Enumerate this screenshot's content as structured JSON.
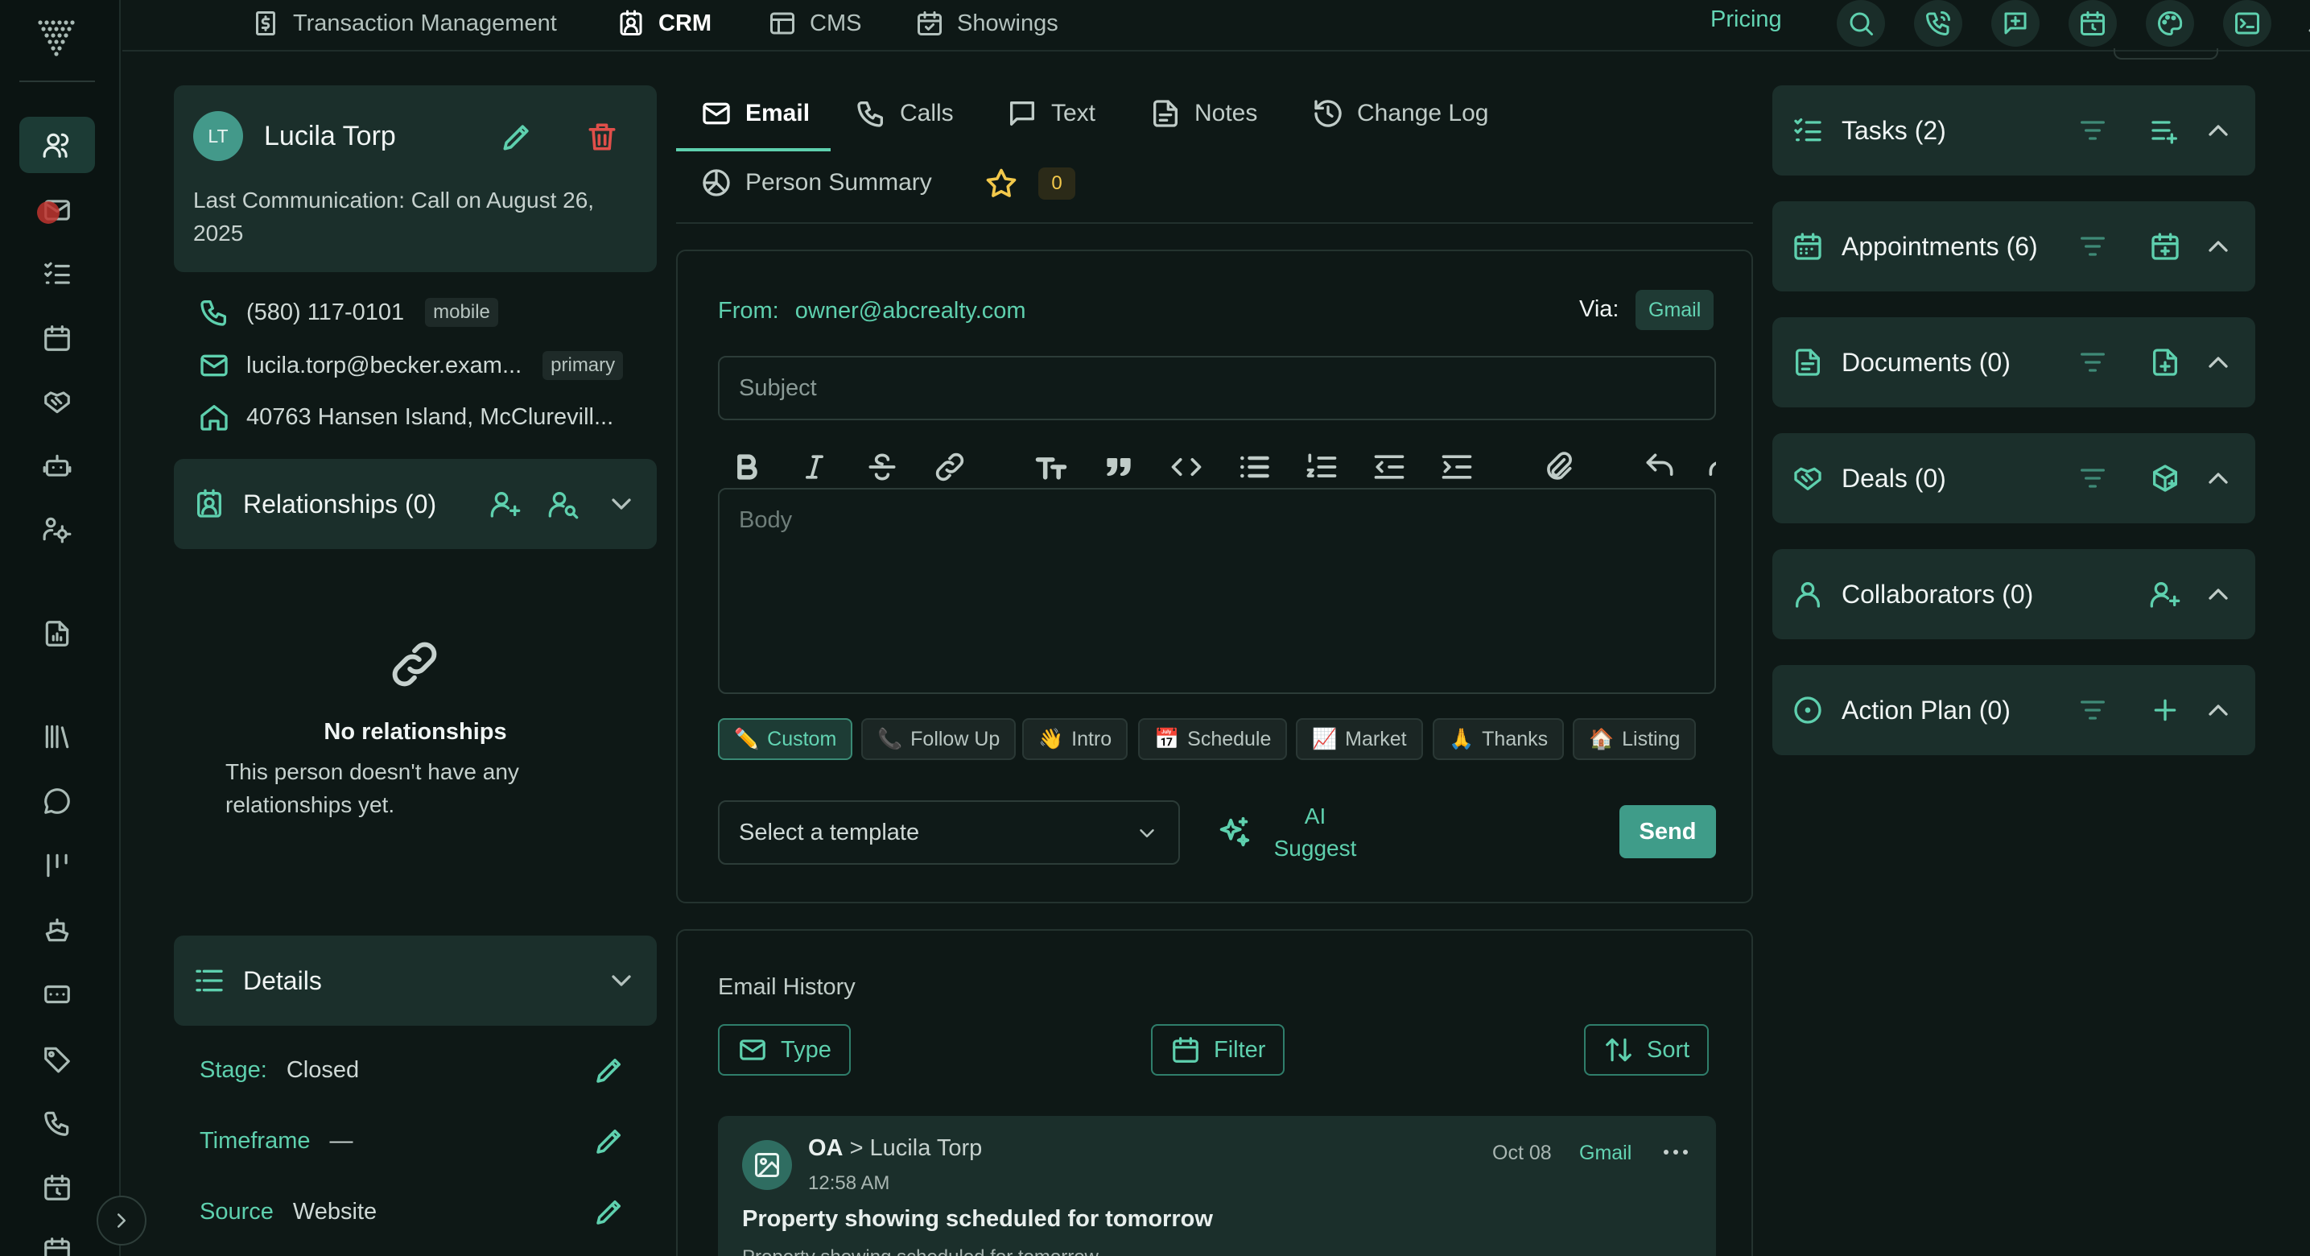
{
  "topnav": {
    "items": [
      {
        "label": "Transaction Management",
        "icon": "dollar-doc-icon"
      },
      {
        "label": "CRM",
        "icon": "contact-book-icon",
        "active": true
      },
      {
        "label": "CMS",
        "icon": "layout-icon"
      },
      {
        "label": "Showings",
        "icon": "calendar-check-icon"
      }
    ],
    "pricing": "Pricing",
    "icons": [
      "search-icon",
      "phone-call-icon",
      "message-plus-icon",
      "calendar-clock-icon",
      "palette-icon",
      "terminal-icon",
      "bell-icon"
    ]
  },
  "sidebar": {
    "icons": [
      "contacts-icon",
      "mail-icon",
      "tasks-icon",
      "calendar-icon",
      "handshake-icon",
      "robot-icon",
      "users-cog-icon",
      "report-icon",
      "library-icon",
      "chat-icon",
      "kanban-icon",
      "ship-icon",
      "ticket-icon",
      "tag-icon",
      "phone-icon",
      "calendar-clock-icon",
      "calendar-icon"
    ],
    "active_index": 0
  },
  "contact": {
    "initials": "LT",
    "name": "Lucila Torp",
    "last_communication": "Last Communication: Call on August 26, 2025",
    "phone": "(580) 117-0101",
    "phone_type": "mobile",
    "email": "lucila.torp@becker.exam...",
    "email_type": "primary",
    "address": "40763 Hansen Island, McClurevill..."
  },
  "relationships": {
    "title": "Relationships (0)",
    "empty_title": "No relationships",
    "empty_desc": "This person doesn't have any relationships yet."
  },
  "details": {
    "title": "Details",
    "rows": [
      {
        "label": "Stage:",
        "value": "Closed"
      },
      {
        "label": "Timeframe",
        "value": "—"
      },
      {
        "label": "Source",
        "value": "Website"
      }
    ]
  },
  "tabs": [
    {
      "label": "Email",
      "icon": "mail-icon",
      "active": true
    },
    {
      "label": "Calls",
      "icon": "phone-icon"
    },
    {
      "label": "Text",
      "icon": "message-icon"
    },
    {
      "label": "Notes",
      "icon": "note-icon"
    },
    {
      "label": "Change Log",
      "icon": "history-icon"
    },
    {
      "label": "Person Summary",
      "icon": "summary-icon"
    }
  ],
  "star_count": "0",
  "composer": {
    "from_label": "From:",
    "from_value": "owner@abcrealty.com",
    "via_label": "Via:",
    "via_value": "Gmail",
    "subject_placeholder": "Subject",
    "body_placeholder": "Body",
    "chips": [
      {
        "emoji": "✏️",
        "label": "Custom",
        "active": true
      },
      {
        "emoji": "📞",
        "label": "Follow Up"
      },
      {
        "emoji": "👋",
        "label": "Intro"
      },
      {
        "emoji": "📅",
        "label": "Schedule"
      },
      {
        "emoji": "📈",
        "label": "Market"
      },
      {
        "emoji": "🙏",
        "label": "Thanks"
      },
      {
        "emoji": "🏠",
        "label": "Listing"
      }
    ],
    "template_placeholder": "Select a template",
    "ai_label": "AI Suggest",
    "send_label": "Send"
  },
  "history": {
    "title": "Email History",
    "type_label": "Type",
    "filter_label": "Filter",
    "sort_label": "Sort",
    "item": {
      "from": "OA",
      "to": "> Lucila Torp",
      "time": "12:58 AM",
      "date": "Oct 08",
      "via": "Gmail",
      "subject": "Property showing scheduled for tomorrow",
      "preview": "Property showing scheduled for tomorrow"
    }
  },
  "right_panels": [
    {
      "title": "Tasks (2)",
      "icon": "tasks-icon",
      "action_icon": "list-add-icon"
    },
    {
      "title": "Appointments (6)",
      "icon": "calendar-icon",
      "action_icon": "calendar-add-icon"
    },
    {
      "title": "Documents (0)",
      "icon": "document-icon",
      "action_icon": "document-add-icon"
    },
    {
      "title": "Deals (0)",
      "icon": "handshake-icon",
      "action_icon": "box-add-icon"
    },
    {
      "title": "Collaborators (0)",
      "icon": "user-icon",
      "action_icon": "user-add-icon"
    },
    {
      "title": "Action Plan (0)",
      "icon": "circle-dot-icon",
      "action_icon": "plus-icon"
    }
  ],
  "colors": {
    "accent": "#5ed0ae",
    "panel": "#1b2f2b",
    "background": "#0e1816",
    "danger": "#e04f4a",
    "send": "#3f9c89"
  }
}
